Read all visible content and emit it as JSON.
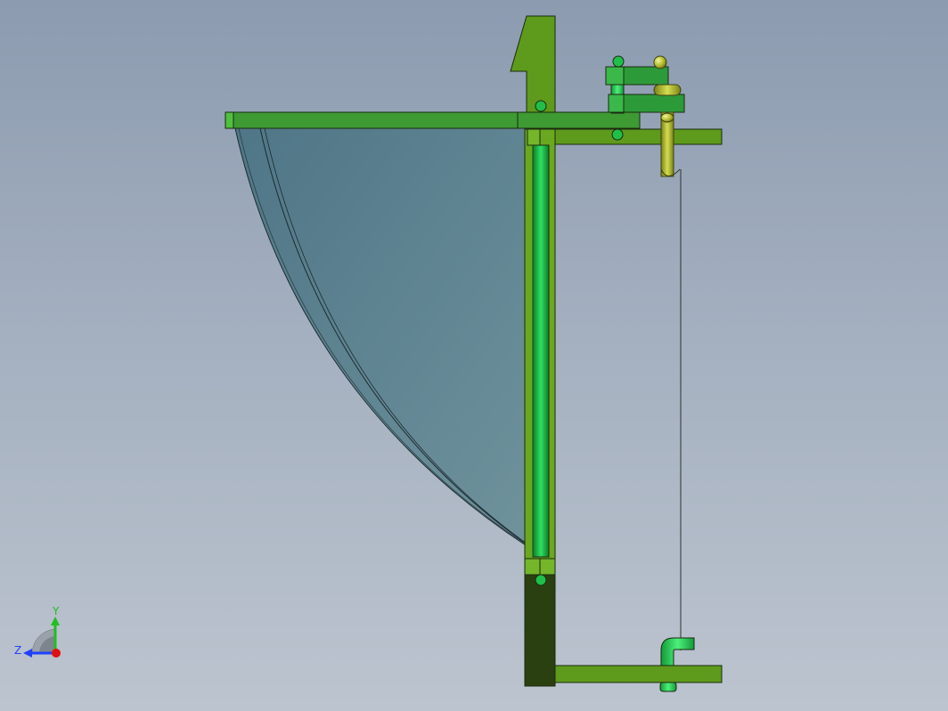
{
  "viewport": {
    "background_top": "#8c9bb0",
    "background_bottom": "#bcc4cf"
  },
  "colors": {
    "frame_green": "#5e9a1c",
    "frame_green_light": "#74b52a",
    "beam_green": "#3e9a32",
    "cylinder_green": "#1fbf4a",
    "block_green": "#2d9a3a",
    "dark_green": "#2b4010",
    "pipe_yellow": "#aab52a",
    "glass": "#557e8c",
    "outline": "#1a2a10"
  },
  "triad": {
    "y_label": "Y",
    "z_label": "Z",
    "y_color": "#1fbf1f",
    "z_color": "#2040ff",
    "origin_color": "#e01010"
  }
}
